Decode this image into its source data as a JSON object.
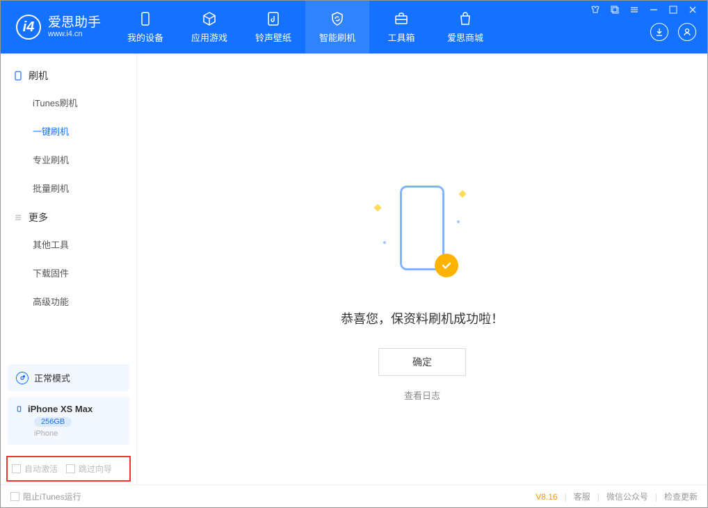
{
  "app": {
    "name": "爱思助手",
    "domain": "www.i4.cn"
  },
  "nav": [
    {
      "label": "我的设备"
    },
    {
      "label": "应用游戏"
    },
    {
      "label": "铃声壁纸"
    },
    {
      "label": "智能刷机"
    },
    {
      "label": "工具箱"
    },
    {
      "label": "爱思商城"
    }
  ],
  "sidebar": {
    "section1": {
      "title": "刷机",
      "items": [
        "iTunes刷机",
        "一键刷机",
        "专业刷机",
        "批量刷机"
      ]
    },
    "section2": {
      "title": "更多",
      "items": [
        "其他工具",
        "下载固件",
        "高级功能"
      ]
    }
  },
  "device": {
    "mode": "正常模式",
    "name": "iPhone XS Max",
    "storage": "256GB",
    "type": "iPhone"
  },
  "options": {
    "auto_activate": "自动激活",
    "skip_guide": "跳过向导"
  },
  "main": {
    "success": "恭喜您，保资料刷机成功啦！",
    "ok": "确定",
    "view_log": "查看日志"
  },
  "footer": {
    "block_itunes": "阻止iTunes运行",
    "version": "V8.16",
    "support": "客服",
    "wechat": "微信公众号",
    "update": "检查更新"
  }
}
